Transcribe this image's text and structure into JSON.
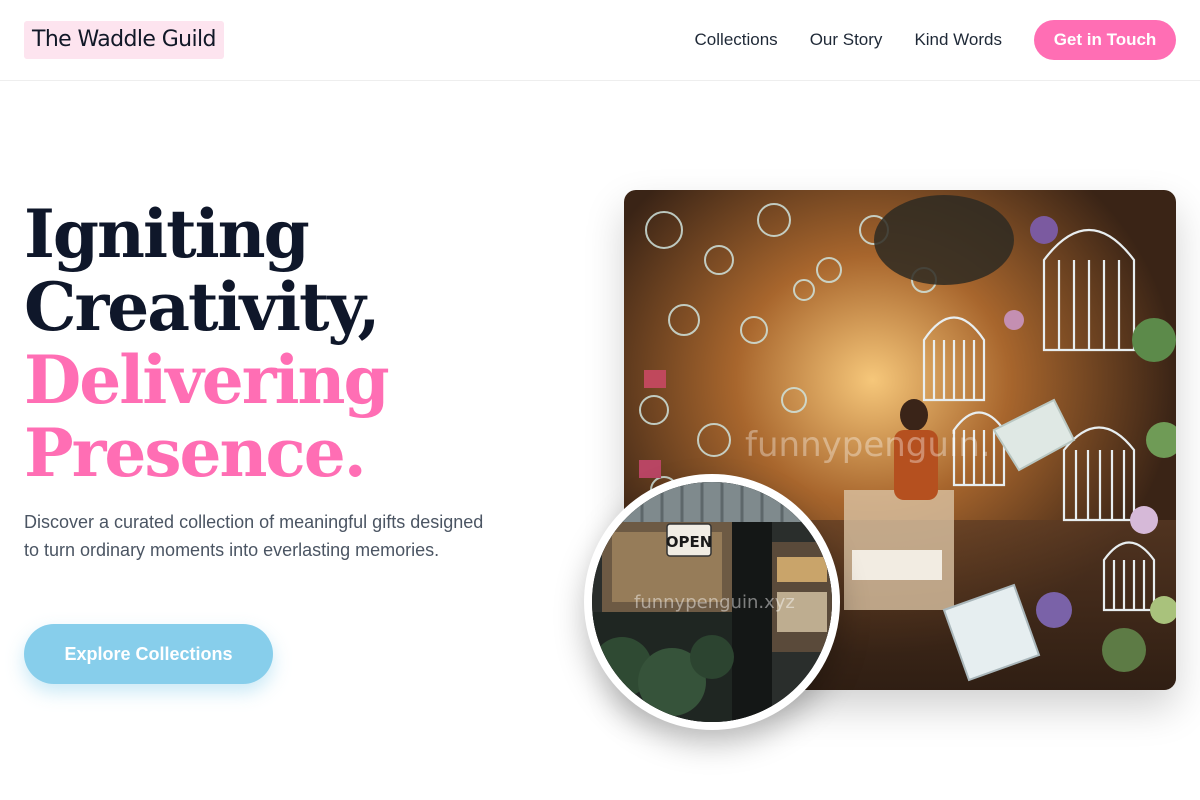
{
  "brand": {
    "name": "The Waddle Guild"
  },
  "nav": {
    "links": [
      "Collections",
      "Our Story",
      "Kind Words"
    ],
    "cta": "Get in Touch"
  },
  "hero": {
    "headline_dark": [
      "Igniting",
      "Creativity,"
    ],
    "headline_accent": [
      "Delivering",
      "Presence."
    ],
    "description": "Discover a curated collection of meaningful gifts designed to turn ordinary moments into everlasting memories.",
    "button": "Explore Collections"
  },
  "images": {
    "main_watermark": "funnypenguin.",
    "round_sign": "OPEN",
    "round_watermark": "funnypenguin.xyz"
  },
  "colors": {
    "accent_pink": "#ff6eb4",
    "logo_bg": "#fde4ef",
    "button_blue": "#87ceeb",
    "heading_dark": "#0f172a"
  }
}
